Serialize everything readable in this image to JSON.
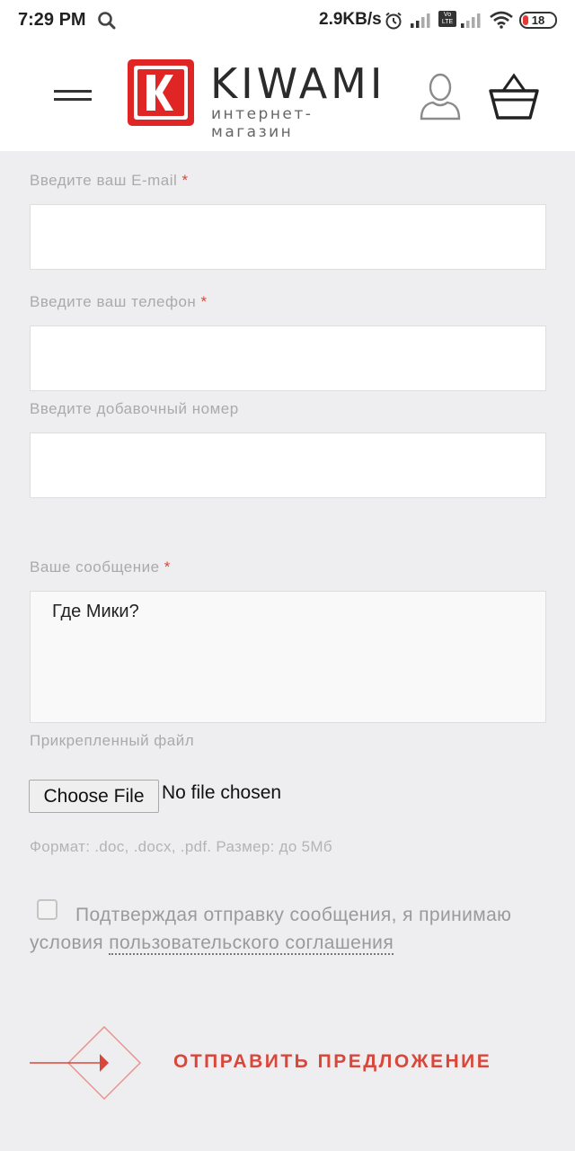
{
  "status_bar": {
    "time": "7:29 PM",
    "speed": "2.9KB/s",
    "volte": "Vo LTE",
    "battery": "18"
  },
  "header": {
    "logo_word": "KIWAMI",
    "logo_subtitle": "интернет-магазин"
  },
  "form": {
    "email_label": "Введите ваш E-mail",
    "email_value": "",
    "phone_label": "Введите ваш телефон",
    "phone_value": "",
    "extension_label": "Введите добавочный номер",
    "extension_value": "",
    "message_label": "Ваше сообщение",
    "message_value": "Где Мики?",
    "required_mark": "*",
    "attachment_label": "Прикрепленный файл",
    "choose_file_button": "Choose File",
    "file_status": "No file chosen",
    "format_note": "Формат: .doc, .docx, .pdf. Размер: до 5Мб",
    "consent_text": "Подтверждая отправку сообщения, я принимаю условия",
    "consent_link": "пользовательского соглашения",
    "consent_checked": false,
    "submit_label": "ОТПРАВИТЬ ПРЕДЛОЖЕНИЕ"
  },
  "colors": {
    "accent": "#d9473b",
    "background": "#eeeef0",
    "label": "#aaaaaa"
  },
  "icons": [
    "search-icon",
    "alarm-icon",
    "signal-icon",
    "wifi-icon",
    "battery-icon",
    "menu-icon",
    "user-icon",
    "cart-icon",
    "arrow-icon"
  ]
}
